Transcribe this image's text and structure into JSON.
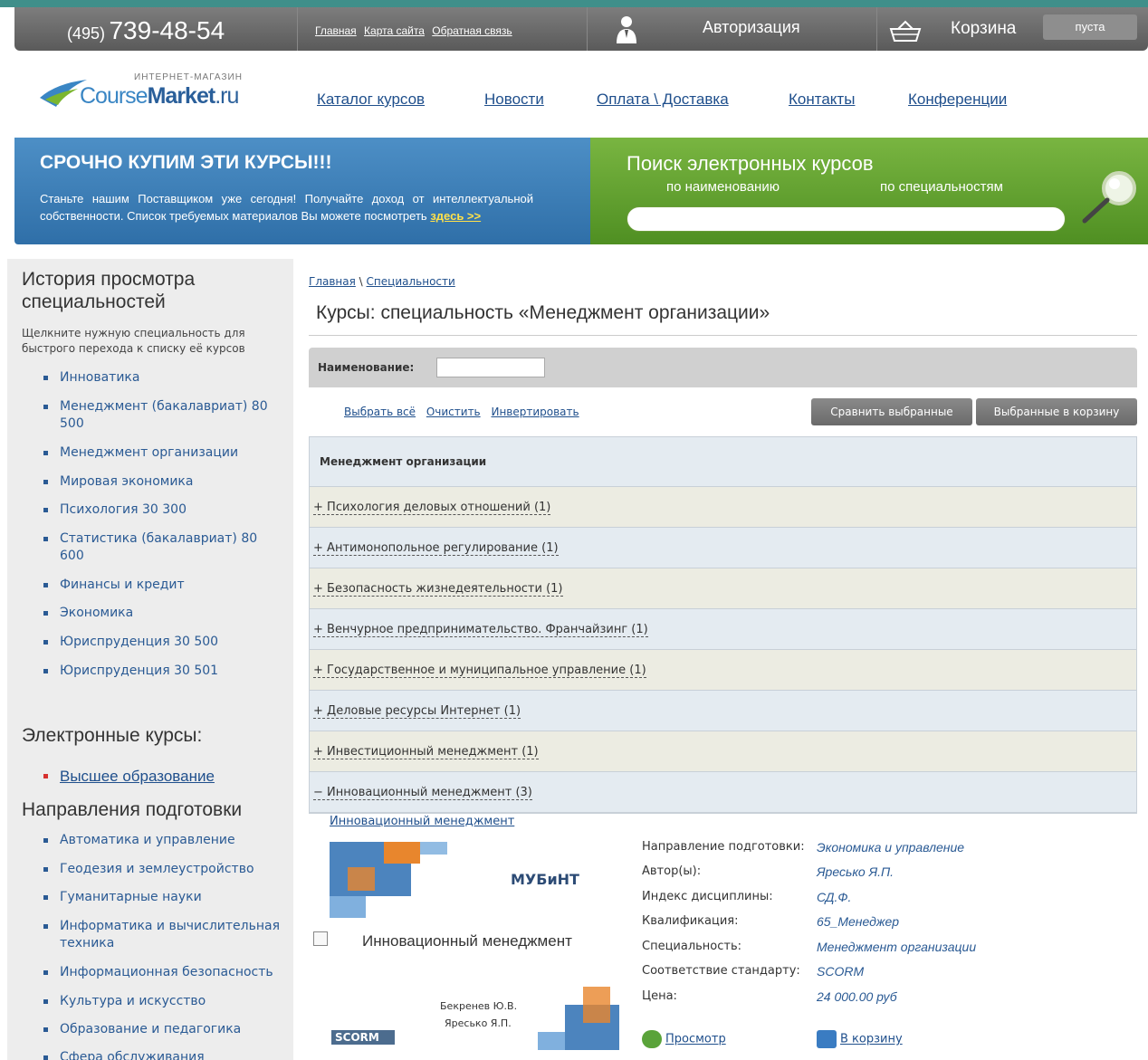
{
  "header": {
    "phone_code": "(495)",
    "phone_number": "739-48-54",
    "links": [
      "Главная",
      "Карта сайта",
      "Обратная связь"
    ],
    "auth_label": "Авторизация",
    "cart_label": "Корзина",
    "cart_status": "пуста"
  },
  "logo": {
    "small_text": "ИНТЕРНЕТ-МАГАЗИН",
    "part1": "Course",
    "part2": "Market",
    "part3": ".ru"
  },
  "nav": [
    "Каталог курсов",
    "Новости",
    "Оплата \\ Доставка",
    "Контакты",
    "Конференции"
  ],
  "promo": {
    "title": "СРОЧНО КУПИМ ЭТИ КУРСЫ!!!",
    "text": "Станьте нашим Поставщиком уже сегодня! Получайте доход от интеллектуальной собственности. Список требуемых материалов Вы можете посмотреть",
    "link": "здесь >>"
  },
  "search": {
    "title": "Поиск электронных курсов",
    "tab_name": "по наименованию",
    "tab_spec": "по специальностям"
  },
  "sidebar": {
    "history_title_1": "История просмотра",
    "history_title_2": "специальностей",
    "hint": "Щелкните нужную специальность для быстрого перехода к списку её курсов",
    "history": [
      "Инноватика",
      "Менеджмент (бакалавриат) 80 500",
      "Менеджмент организации",
      "Мировая экономика",
      "Психология 30 300",
      "Статистика (бакалавриат) 80 600",
      "Финансы и кредит",
      "Экономика",
      "Юриспруденция 30 500",
      "Юриспруденция 30 501"
    ],
    "ecourses_title": "Электронные курсы:",
    "ecourses": [
      "Высшее образование"
    ],
    "directions_title": "Направления подготовки",
    "directions": [
      "Автоматика и управление",
      "Геодезия и землеустройство",
      "Гуманитарные науки",
      "Информатика и вычислительная техника",
      "Информационная безопасность",
      "Культура и искусство",
      "Образование и педагогика",
      "Сфера обслуживания"
    ]
  },
  "main": {
    "breadcrumb": [
      "Главная",
      "Специальности"
    ],
    "breadcrumb_sep": "\\",
    "title": "Курсы: специальность «Менеджмент организации»",
    "filter_label": "Наименование:",
    "filter_value": "",
    "actions": [
      "Выбрать всё",
      "Очистить",
      "Инвертировать"
    ],
    "compare_button": "Сравнить выбранные",
    "to_cart_button": "Выбранные в корзину",
    "group_title": "Менеджмент организации",
    "rows": [
      {
        "sign": "+",
        "label": "Психология деловых отношений (1)"
      },
      {
        "sign": "+",
        "label": "Антимонопольное регулирование (1)"
      },
      {
        "sign": "+",
        "label": "Безопасность жизнедеятельности (1)"
      },
      {
        "sign": "+",
        "label": "Венчурное предпринимательство. Франчайзинг (1)"
      },
      {
        "sign": "+",
        "label": "Государственное и муниципальное управление (1)"
      },
      {
        "sign": "+",
        "label": "Деловые ресурсы Интернет (1)"
      },
      {
        "sign": "+",
        "label": "Инвестиционный менеджмент (1)"
      },
      {
        "sign": "−",
        "label": "Инновационный менеджмент (3)"
      }
    ],
    "course": {
      "link": "Инновационный менеджмент",
      "cover_title": "Инновационный менеджмент",
      "cover_author1": "Бекренев Ю.В.",
      "cover_author2": "Яресько Я.П.",
      "cover_brand": "МУБиНТ",
      "cover_badge": "SCORM",
      "props": [
        {
          "k": "Направление подготовки:",
          "v": "Экономика и управление"
        },
        {
          "k": "Автор(ы):",
          "v": "Яресько Я.П."
        },
        {
          "k": "Индекс дисциплины:",
          "v": "СД.Ф."
        },
        {
          "k": "Квалификация:",
          "v": "65_Менеджер"
        },
        {
          "k": "Специальность:",
          "v": "Менеджмент организации"
        },
        {
          "k": "Соответствие стандарту:",
          "v": "SCORM"
        },
        {
          "k": "Цена:",
          "v": "24 000.00 руб"
        }
      ],
      "view_label": "Просмотр",
      "buy_label": "В корзину"
    }
  }
}
